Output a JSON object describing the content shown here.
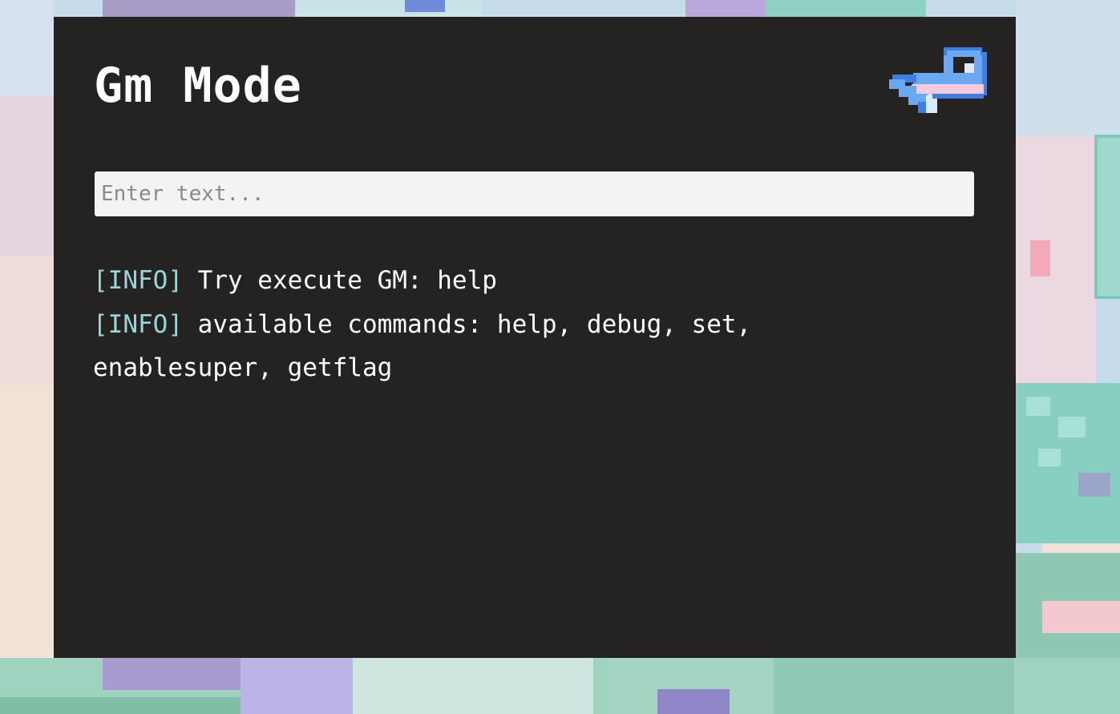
{
  "colors": {
    "panel_bg": "#252222",
    "title_text": "#ffffff",
    "info_tag": "#9ad5dc",
    "message_text": "#ffffff",
    "input_bg": "#f3f3f3",
    "input_placeholder": "#8a8a8a",
    "back_arrow": "#6aa8f2"
  },
  "panel": {
    "title": "Gm Mode",
    "back_icon": "return-arrow-icon"
  },
  "input": {
    "value": "",
    "placeholder": "Enter text..."
  },
  "log": [
    {
      "tag": "[INFO]",
      "message": "Try execute GM: help"
    },
    {
      "tag": "[INFO]",
      "message": "available commands: help, debug, set, enablesuper, getflag"
    }
  ]
}
